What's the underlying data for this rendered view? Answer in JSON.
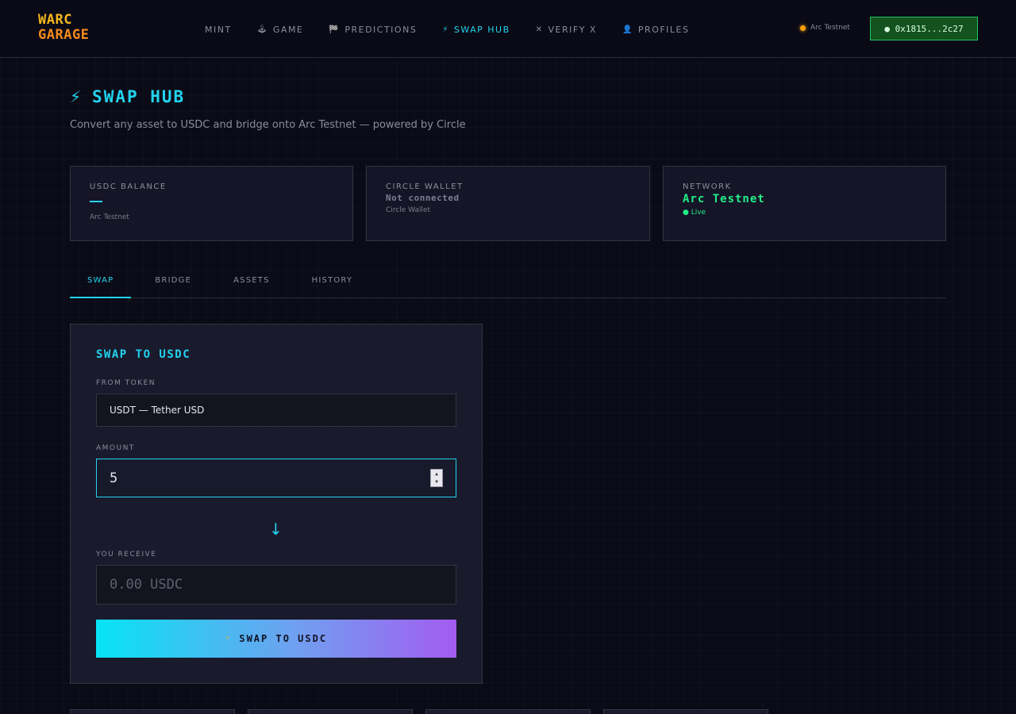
{
  "header": {
    "logo_line1": "WARC",
    "logo_line2": "GARAGE",
    "nav": [
      {
        "icon": "",
        "label": "MINT"
      },
      {
        "icon": "🕹",
        "label": "GAME"
      },
      {
        "icon": "🏁",
        "label": "PREDICTIONS"
      },
      {
        "icon": "⚡",
        "label": "SWAP HUB"
      },
      {
        "icon": "✕",
        "label": "VERIFY X"
      },
      {
        "icon": "👤",
        "label": "PROFILES"
      }
    ],
    "network_label": "Arc Testnet",
    "wallet_address": "● 0x1815...2c27"
  },
  "page": {
    "title": "SWAP HUB",
    "subtitle": "Convert any asset to USDC and bridge onto Arc Testnet — powered by Circle"
  },
  "stats": {
    "usdc": {
      "label": "USDC BALANCE",
      "sub": "Arc Testnet"
    },
    "circle": {
      "label": "CIRCLE WALLET",
      "value": "Not connected",
      "sub": "Circle Wallet"
    },
    "network": {
      "label": "NETWORK",
      "value": "Arc Testnet",
      "sub": "● Live"
    }
  },
  "tabs": [
    "SWAP",
    "BRIDGE",
    "ASSETS",
    "HISTORY"
  ],
  "swap": {
    "title": "SWAP TO USDC",
    "from_label": "FROM TOKEN",
    "from_value": "USDT — Tether USD",
    "amount_label": "AMOUNT",
    "amount_value": "5",
    "receive_label": "YOU RECEIVE",
    "receive_value": "0.00 USDC",
    "button_label": "SWAP TO USDC",
    "button_icon": "⚡"
  },
  "colors": {
    "accent": "#22d3ee",
    "logo_top": "#f5b81c",
    "logo_bottom": "#f58a1c",
    "live_green": "#22ee88",
    "wallet_green": "#22c55e"
  }
}
